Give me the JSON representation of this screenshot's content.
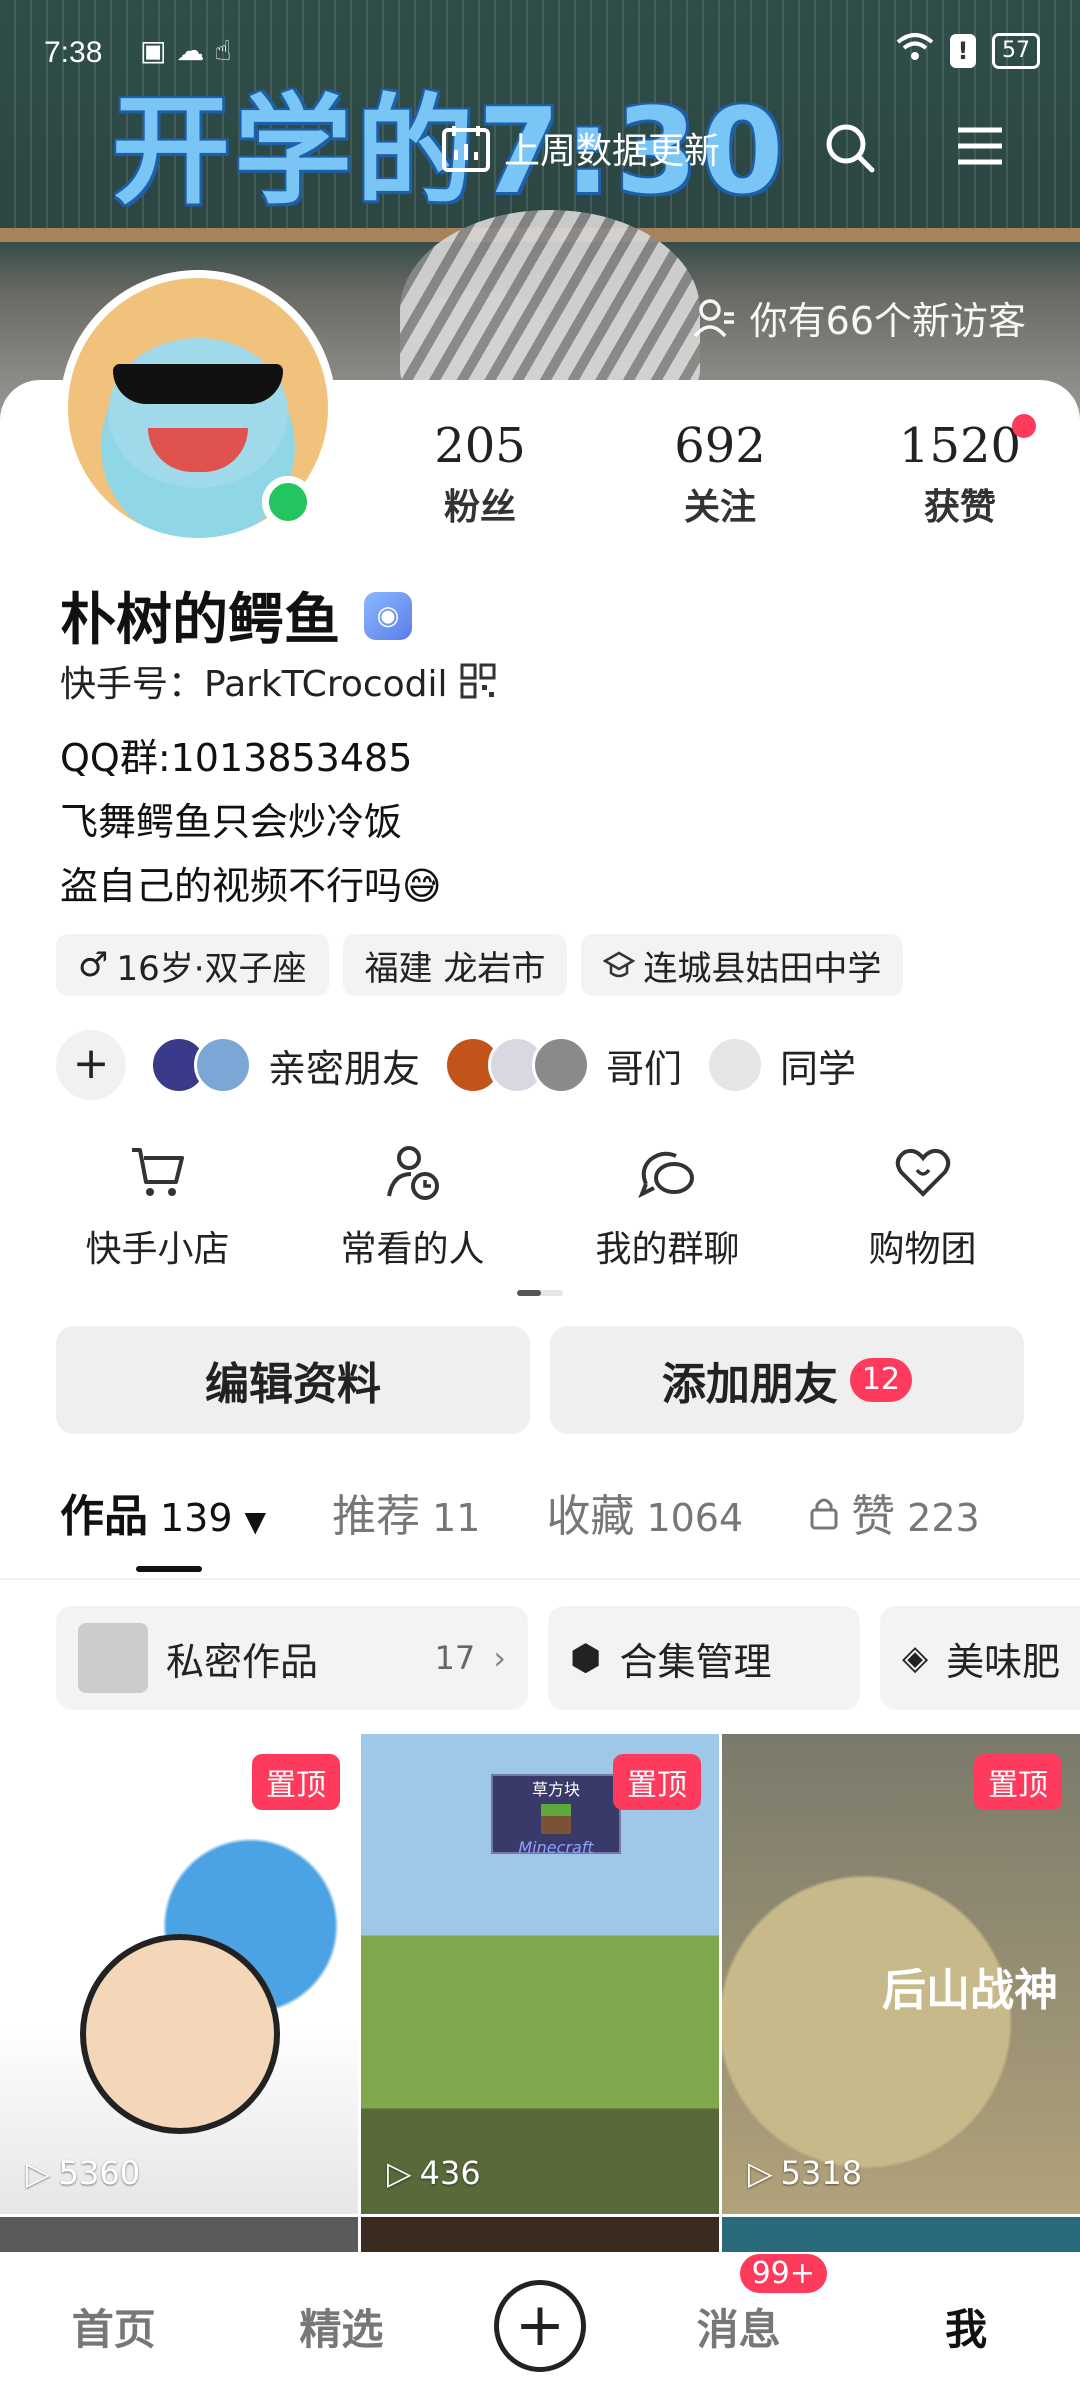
{
  "status_bar": {
    "time": "7:38",
    "battery": "57"
  },
  "banner": {
    "title": "开学的7:30",
    "update_label": "上周数据更新",
    "visitors_text": "你有66个新访客"
  },
  "profile": {
    "name": "朴树的鳄鱼",
    "kuaishou_id": "快手号：ParkTCrocodil",
    "qq_group": "QQ群:1013853485",
    "bio_line1": "飞舞鳄鱼只会炒冷饭",
    "bio_line2": "盗自己的视频不行吗😅"
  },
  "stats": [
    {
      "value": "205",
      "label": "粉丝"
    },
    {
      "value": "692",
      "label": "关注"
    },
    {
      "value": "1520",
      "label": "获赞"
    }
  ],
  "tags": [
    {
      "icon": "male-icon",
      "text": "16岁·双子座"
    },
    {
      "icon": "",
      "text": "福建 龙岩市"
    },
    {
      "icon": "school-icon",
      "text": "连城县姑田中学"
    }
  ],
  "groups": [
    {
      "label": "亲密朋友"
    },
    {
      "label": "哥们"
    },
    {
      "label": "同学"
    }
  ],
  "shortcuts": [
    {
      "icon": "cart-icon",
      "label": "快手小店"
    },
    {
      "icon": "person-clock-icon",
      "label": "常看的人"
    },
    {
      "icon": "group-chat-icon",
      "label": "我的群聊"
    },
    {
      "icon": "heart-bag-icon",
      "label": "购物团"
    }
  ],
  "actions": {
    "edit_label": "编辑资料",
    "add_friend_label": "添加朋友",
    "add_friend_badge": "12"
  },
  "tabs": [
    {
      "label": "作品",
      "count": "139"
    },
    {
      "label": "推荐",
      "count": "11"
    },
    {
      "label": "收藏",
      "count": "1064"
    },
    {
      "label": "赞",
      "count": "223"
    }
  ],
  "collections": [
    {
      "label": "私密作品",
      "count": "17"
    },
    {
      "label": "合集管理"
    },
    {
      "label": "美味肥"
    }
  ],
  "videos": [
    {
      "pin": "置顶",
      "plays": "5360"
    },
    {
      "pin": "置顶",
      "plays": "436",
      "overlay_title": "草方块",
      "overlay_sub": "Minecraft"
    },
    {
      "pin": "置顶",
      "plays": "5318",
      "overlay_title": "后山战神"
    }
  ],
  "bottom_nav": {
    "home": "首页",
    "featured": "精选",
    "messages": "消息",
    "messages_badge": "99+",
    "me": "我"
  },
  "colors": {
    "accent": "#fe3b5c",
    "online": "#22c55e"
  }
}
